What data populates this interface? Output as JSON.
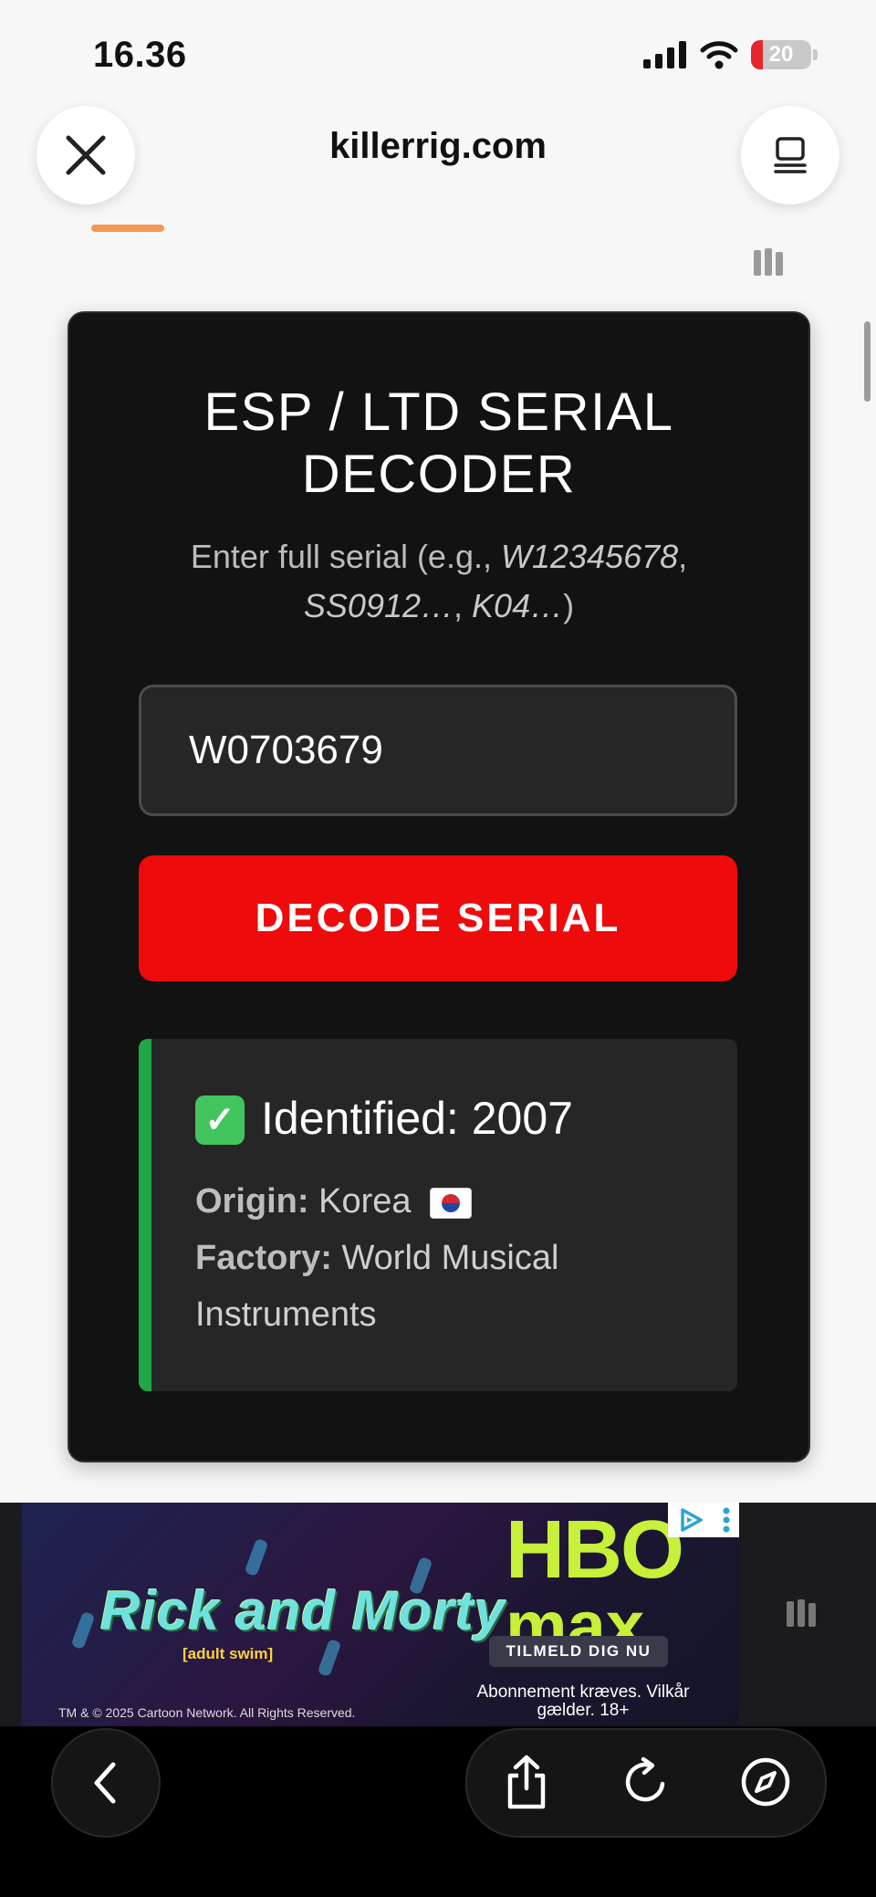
{
  "status_bar": {
    "time": "16.36",
    "battery_percent": "20",
    "battery_level": 0.2,
    "low_battery_color": "#e5262e"
  },
  "browser": {
    "url": "killerrig.com",
    "close_icon": "close-icon",
    "tabs_icon": "tabs-overview-icon"
  },
  "card": {
    "title_line1": "ESP / LTD SERIAL",
    "title_line2": "DECODER",
    "subtitle_prefix": "Enter full serial (e.g., ",
    "example1": "W12345678",
    "sep1": ",",
    "example2": "SS0912…",
    "sep2": ", ",
    "example3": "K04…",
    "subtitle_suffix": ")",
    "serial_value": "W0703679",
    "decode_label": "DECODE SERIAL",
    "accent_color": "#ee0b0b"
  },
  "result": {
    "title": "Identified: 2007",
    "origin_label": "Origin:",
    "origin_value": "Korea",
    "factory_label": "Factory:",
    "factory_value": "World Musical Instruments",
    "status_color": "#21a645"
  },
  "ad": {
    "show_title": "Rick and Morty",
    "show_sub": "[adult swim]",
    "copyright": "TM & © 2025 Cartoon Network. All Rights Reserved.",
    "brand_line1": "HBO",
    "brand_line2": "max",
    "cta": "TILMELD DIG NU",
    "terms": "Abonnement kræves. Vilkår gælder. 18+"
  },
  "toolbar": {
    "back_icon": "back-icon",
    "share_icon": "share-icon",
    "reload_icon": "reload-icon",
    "compass_icon": "compass-icon"
  }
}
